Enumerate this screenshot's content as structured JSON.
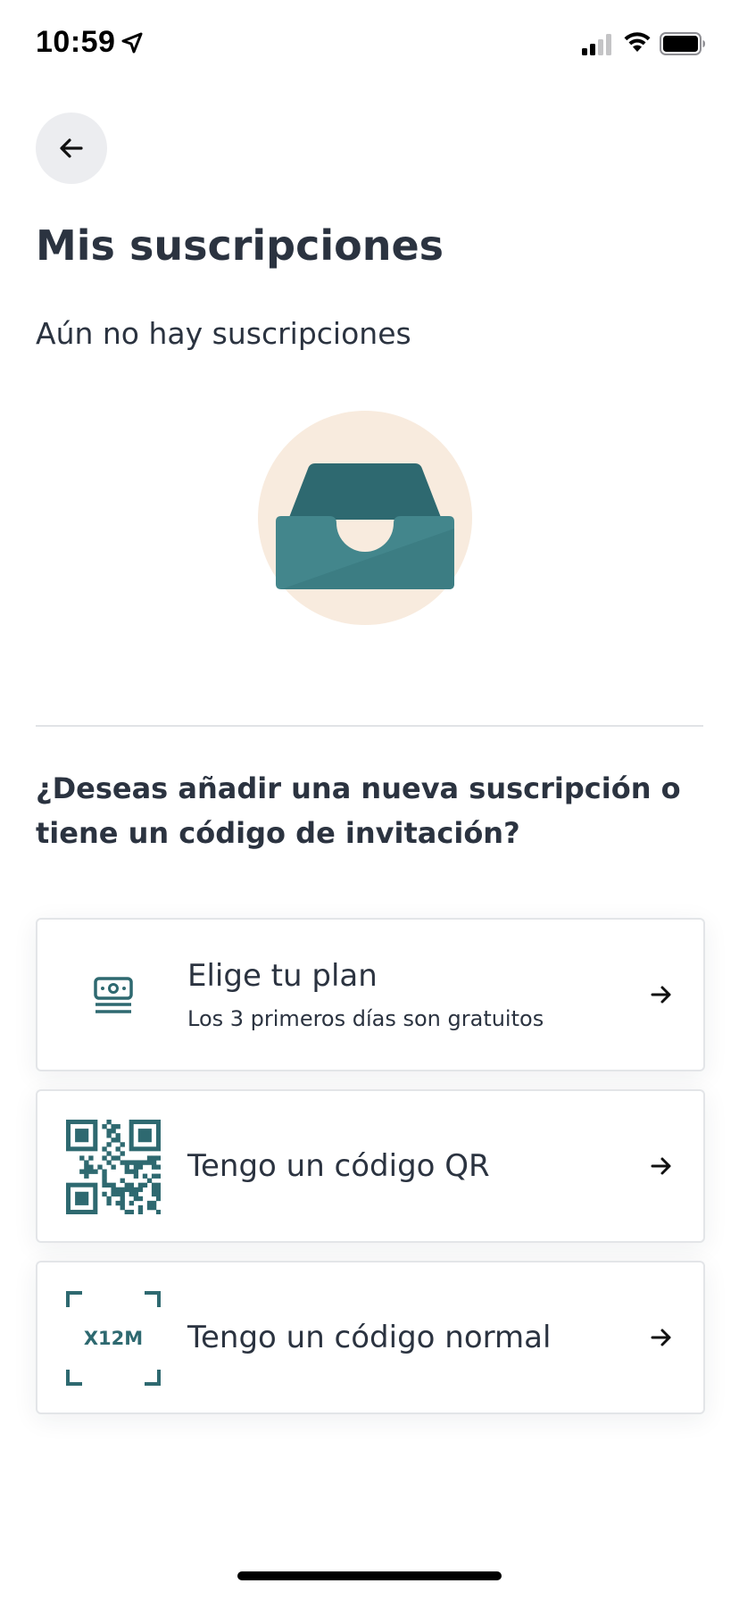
{
  "status_bar": {
    "time": "10:59"
  },
  "header": {
    "back_icon": "arrow-left-icon"
  },
  "page": {
    "title": "Mis suscripciones",
    "empty_message": "Aún no hay suscripciones",
    "illustration": "inbox-tray-icon",
    "question": "¿Deseas añadir una nueva suscripción o tiene un código de invitación?"
  },
  "options": [
    {
      "icon": "money-stack-icon",
      "title": "Elige tu plan",
      "subtitle": "Los 3 primeros días son gratuitos"
    },
    {
      "icon": "qr-code-icon",
      "title": "Tengo un código QR"
    },
    {
      "icon": "code-frame-icon",
      "code_sample": "X12M",
      "title": "Tengo un código normal"
    }
  ],
  "colors": {
    "teal": "#2e6970",
    "teal_light": "#43868c",
    "circle": "#f8ebde",
    "text": "#2b3340"
  }
}
